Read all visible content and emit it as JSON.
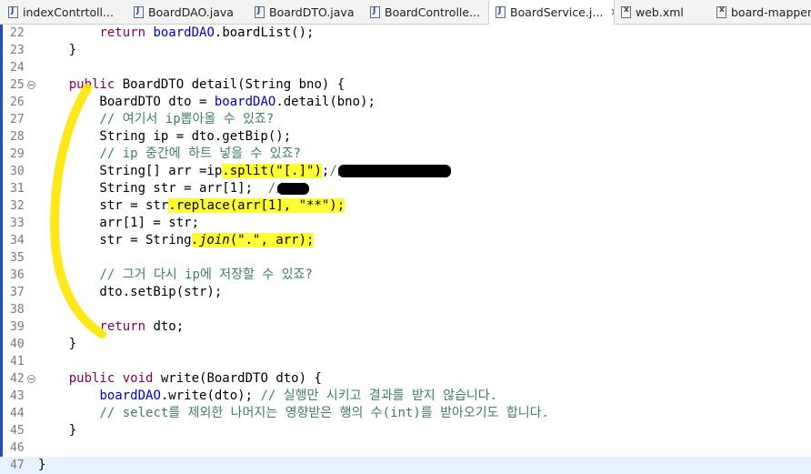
{
  "tabs": [
    {
      "label": "indexContrtoll...",
      "icon": "java-file-icon",
      "active": false
    },
    {
      "label": "BoardDAO.java",
      "icon": "java-file-icon",
      "active": false
    },
    {
      "label": "BoardDTO.java",
      "icon": "java-file-icon",
      "active": false
    },
    {
      "label": "BoardControlle...",
      "icon": "java-file-icon",
      "active": false
    },
    {
      "label": "BoardService.j...",
      "icon": "java-file-icon",
      "active": true
    },
    {
      "label": "web.xml",
      "icon": "xml-file-icon",
      "active": false
    },
    {
      "label": "board-mapper.x...",
      "icon": "xml-file-icon",
      "active": false
    }
  ],
  "close_glyph": "✕",
  "lines": [
    {
      "n": "22",
      "t": [
        [
          "        ",
          ""
        ],
        [
          "return",
          "kw"
        ],
        [
          " ",
          ""
        ],
        [
          "boardDAO",
          "fld"
        ],
        [
          ".boardList();",
          ""
        ]
      ]
    },
    {
      "n": "23",
      "t": [
        [
          "    }",
          ""
        ]
      ]
    },
    {
      "n": "24",
      "t": []
    },
    {
      "n": "25",
      "fold": true,
      "t": [
        [
          "    ",
          ""
        ],
        [
          "public",
          "kw"
        ],
        [
          " BoardDTO detail(String bno) {",
          ""
        ]
      ]
    },
    {
      "n": "26",
      "t": [
        [
          "        BoardDTO dto = ",
          ""
        ],
        [
          "boardDAO",
          "fld"
        ],
        [
          ".detail(bno);",
          ""
        ]
      ]
    },
    {
      "n": "27",
      "t": [
        [
          "        ",
          ""
        ],
        [
          "// 여기서 ip뽑아올 수 있죠?",
          "cmt"
        ]
      ]
    },
    {
      "n": "28",
      "t": [
        [
          "        String ip = dto.getBip();",
          ""
        ]
      ]
    },
    {
      "n": "29",
      "t": [
        [
          "        ",
          ""
        ],
        [
          "// ip 중간에 하트 넣을 수 있죠?",
          "cmt"
        ]
      ]
    },
    {
      "n": "30",
      "t": [
        [
          "        String[] arr =ip",
          ""
        ],
        [
          ".split(\"[.]\")",
          "hl"
        ],
        [
          ";",
          ""
        ],
        [
          "// ",
          "cmt"
        ]
      ]
    },
    {
      "n": "31",
      "t": [
        [
          "        String str = arr[1];  ",
          ""
        ],
        [
          "// ",
          "cmt"
        ]
      ]
    },
    {
      "n": "32",
      "t": [
        [
          "        str = str",
          ""
        ],
        [
          ".replace(arr[1], \"**\");",
          "hl"
        ]
      ]
    },
    {
      "n": "33",
      "t": [
        [
          "        arr[1] = str;",
          ""
        ]
      ]
    },
    {
      "n": "34",
      "t": [
        [
          "        str = String",
          ""
        ],
        [
          ".join",
          "hl it"
        ],
        [
          "(\".\", arr);",
          "hl"
        ]
      ]
    },
    {
      "n": "35",
      "t": []
    },
    {
      "n": "36",
      "t": [
        [
          "        ",
          ""
        ],
        [
          "// 그거 다시 ip에 저장할 수 있죠?",
          "cmt"
        ]
      ]
    },
    {
      "n": "37",
      "t": [
        [
          "        dto.setBip(str);",
          ""
        ]
      ]
    },
    {
      "n": "38",
      "t": []
    },
    {
      "n": "39",
      "t": [
        [
          "        ",
          ""
        ],
        [
          "return",
          "kw"
        ],
        [
          " dto;",
          ""
        ]
      ]
    },
    {
      "n": "40",
      "t": [
        [
          "    }",
          ""
        ]
      ]
    },
    {
      "n": "41",
      "t": []
    },
    {
      "n": "42",
      "fold": true,
      "t": [
        [
          "    ",
          ""
        ],
        [
          "public",
          "kw"
        ],
        [
          " ",
          ""
        ],
        [
          "void",
          "kw"
        ],
        [
          " write(BoardDTO dto) {",
          ""
        ]
      ]
    },
    {
      "n": "43",
      "t": [
        [
          "        ",
          ""
        ],
        [
          "boardDAO",
          "fld"
        ],
        [
          ".write(dto); ",
          ""
        ],
        [
          "// 실행만 시키고 결과를 받지 않습니다.",
          "cmt"
        ]
      ]
    },
    {
      "n": "44",
      "t": [
        [
          "        ",
          ""
        ],
        [
          "// select를 제외한 나머지는 영향받은 행의 수(int)를 받아오기도 합니다.",
          "cmt"
        ]
      ]
    },
    {
      "n": "45",
      "t": [
        [
          "    }",
          ""
        ]
      ]
    },
    {
      "n": "46",
      "t": []
    },
    {
      "n": "47",
      "t": [
        [
          "}",
          ""
        ]
      ]
    }
  ]
}
